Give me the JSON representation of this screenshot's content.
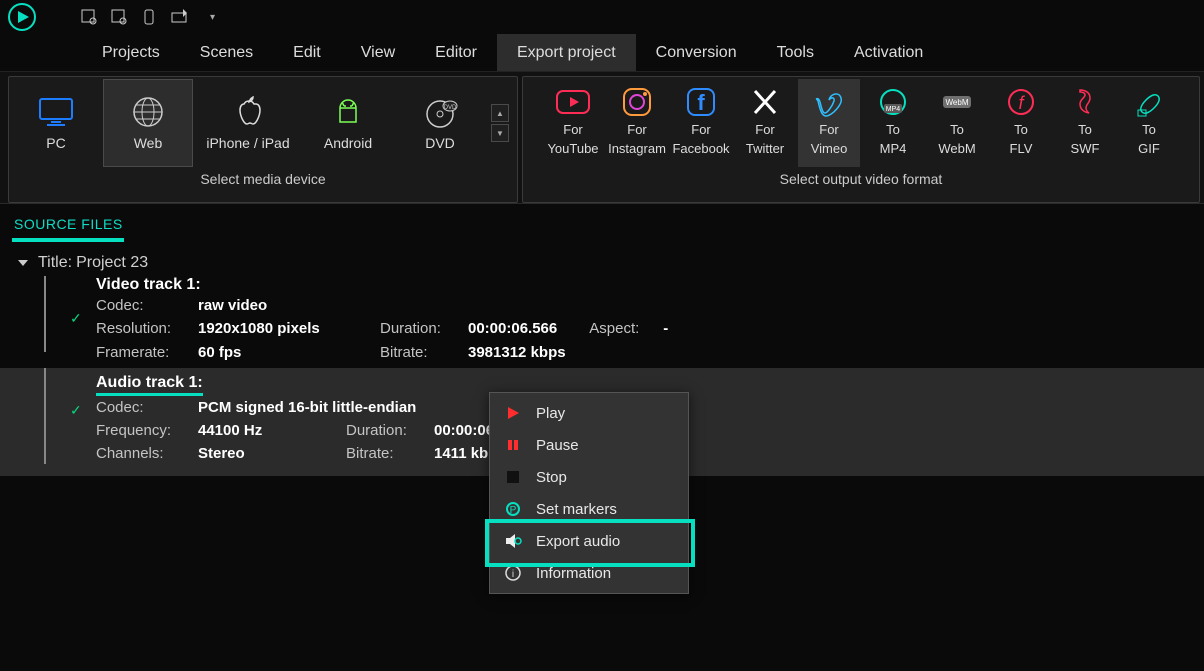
{
  "tabs": [
    "Projects",
    "Scenes",
    "Edit",
    "View",
    "Editor",
    "Export project",
    "Conversion",
    "Tools",
    "Activation"
  ],
  "active_tab": "Export project",
  "media_devices": {
    "items": [
      "PC",
      "Web",
      "iPhone / iPad",
      "Android",
      "DVD"
    ],
    "active": "Web",
    "caption": "Select media device"
  },
  "output_formats": {
    "items": [
      {
        "l1": "For",
        "l2": "YouTube"
      },
      {
        "l1": "For",
        "l2": "Instagram"
      },
      {
        "l1": "For",
        "l2": "Facebook"
      },
      {
        "l1": "For",
        "l2": "Twitter"
      },
      {
        "l1": "For",
        "l2": "Vimeo"
      },
      {
        "l1": "To",
        "l2": "MP4"
      },
      {
        "l1": "To",
        "l2": "WebM"
      },
      {
        "l1": "To",
        "l2": "FLV"
      },
      {
        "l1": "To",
        "l2": "SWF"
      },
      {
        "l1": "To",
        "l2": "GIF"
      }
    ],
    "active_index": 4,
    "caption": "Select output video format"
  },
  "source_files": {
    "header": "SOURCE FILES",
    "title_label": "Title:",
    "title_value": "Project 23",
    "video": {
      "header": "Video track 1:",
      "codec_label": "Codec:",
      "codec": "raw video",
      "resolution_label": "Resolution:",
      "resolution": "1920x1080 pixels",
      "duration_label": "Duration:",
      "duration": "00:00:06.566",
      "aspect_label": "Aspect:",
      "aspect": "-",
      "framerate_label": "Framerate:",
      "framerate": "60 fps",
      "bitrate_label": "Bitrate:",
      "bitrate": "3981312 kbps"
    },
    "audio": {
      "header": "Audio track 1:",
      "codec_label": "Codec:",
      "codec": "PCM signed 16-bit little-endian",
      "frequency_label": "Frequency:",
      "frequency": "44100 Hz",
      "duration_label": "Duration:",
      "duration": "00:00:06.566",
      "channels_label": "Channels:",
      "channels": "Stereo",
      "bitrate_label": "Bitrate:",
      "bitrate": "1411 kbps"
    }
  },
  "context_menu": {
    "items": [
      "Play",
      "Pause",
      "Stop",
      "Set markers",
      "Export audio",
      "Information"
    ],
    "highlighted": "Export audio"
  }
}
